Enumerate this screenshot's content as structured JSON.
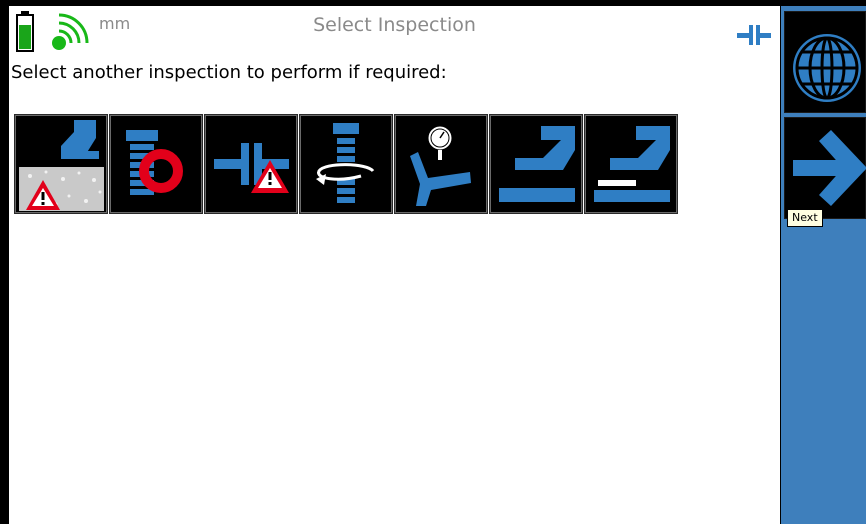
{
  "status": {
    "units": "mm",
    "battery_level": 0.7,
    "signal_bars": 3
  },
  "header": {
    "title": "Select Inspection"
  },
  "instruction": "Select another inspection to perform if required:",
  "inspections": [
    {
      "icon": "weld-on-concrete-warning-icon"
    },
    {
      "icon": "bolt-with-red-ring-icon"
    },
    {
      "icon": "connector-warning-icon"
    },
    {
      "icon": "screw-rotation-icon"
    },
    {
      "icon": "pressure-gauge-pipe-icon"
    },
    {
      "icon": "weld-angle-icon"
    },
    {
      "icon": "weld-angle-with-gap-icon"
    }
  ],
  "sidebar": {
    "buttons": [
      {
        "icon": "globe-icon"
      },
      {
        "icon": "arrow-right-icon"
      }
    ],
    "tooltip": "Next"
  },
  "colors": {
    "accent": "#3e7fbc",
    "warning": "#e2001a",
    "battery": "#1aa51a",
    "signal": "#18b818",
    "gray_text": "#8a8a8a"
  }
}
